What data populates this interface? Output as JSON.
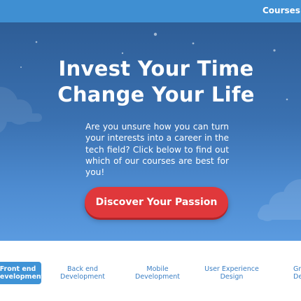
{
  "nav": {
    "courses_label": "Courses"
  },
  "hero": {
    "title_line1": "Invest Your Time",
    "title_line2": "Change Your Life",
    "description": "Are you unsure how you can turn your interests into a career in the tech field? Click below to find out which of our courses are best for you!",
    "cta_label": "Discover Your Passion"
  },
  "tabs": [
    {
      "line1": "Front end",
      "line2": "Development",
      "active": true
    },
    {
      "line1": "Back end",
      "line2": "Development",
      "active": false
    },
    {
      "line1": "Mobile",
      "line2": "Development",
      "active": false
    },
    {
      "line1": "User Experience",
      "line2": "Design",
      "active": false
    },
    {
      "line1": "Graphic",
      "line2": "Design",
      "active": false
    }
  ],
  "colors": {
    "nav_bar": "#3f8fd2",
    "hero_top": "#2e5d96",
    "hero_bottom": "#5b9be0",
    "cta": "#e0383b",
    "tab_active": "#3f93d6",
    "tab_text": "#3b7fc4"
  }
}
